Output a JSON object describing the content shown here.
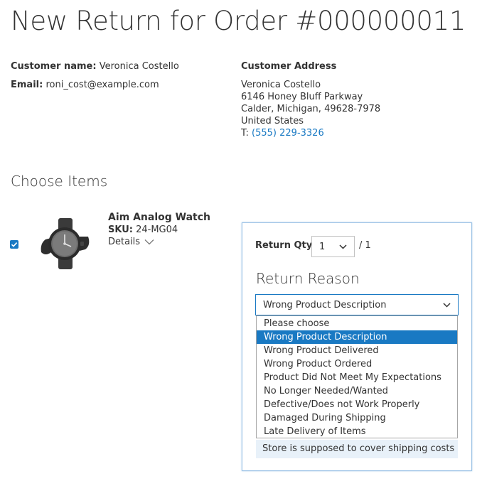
{
  "page": {
    "title": "New Return for Order #000000011"
  },
  "customer": {
    "name_label": "Customer name:",
    "name": "Veronica Costello",
    "email_label": "Email:",
    "email": "roni_cost@example.com"
  },
  "address": {
    "heading": "Customer Address",
    "lines": [
      "Veronica Costello",
      "6146 Honey Bluff Parkway",
      "Calder, Michigan, 49628-7978",
      "United States"
    ],
    "phone_prefix": "T:",
    "phone": "(555) 229-3326"
  },
  "items": {
    "heading": "Choose Items",
    "product": {
      "name": "Aim Analog Watch",
      "sku_label": "SKU:",
      "sku": "24-MG04",
      "details_label": "Details",
      "checked": true
    }
  },
  "return_form": {
    "qty_label": "Return Qty",
    "qty_value": "1",
    "qty_total": "/ 1",
    "reason_heading": "Return Reason",
    "reason_selected": "Wrong Product Description",
    "reason_options": [
      "Please choose",
      "Wrong Product Description",
      "Wrong Product Delivered",
      "Wrong Product Ordered",
      "Product Did Not Meet My Expectations",
      "No Longer Needed/Wanted",
      "Defective/Does not Work Properly",
      "Damaged During Shipping",
      "Late Delivery of Items"
    ],
    "selected_index": 1,
    "note": "Store is supposed to cover shipping costs"
  },
  "colors": {
    "accent": "#1979c3",
    "text": "#333333",
    "box_border": "#9dc3e6"
  }
}
